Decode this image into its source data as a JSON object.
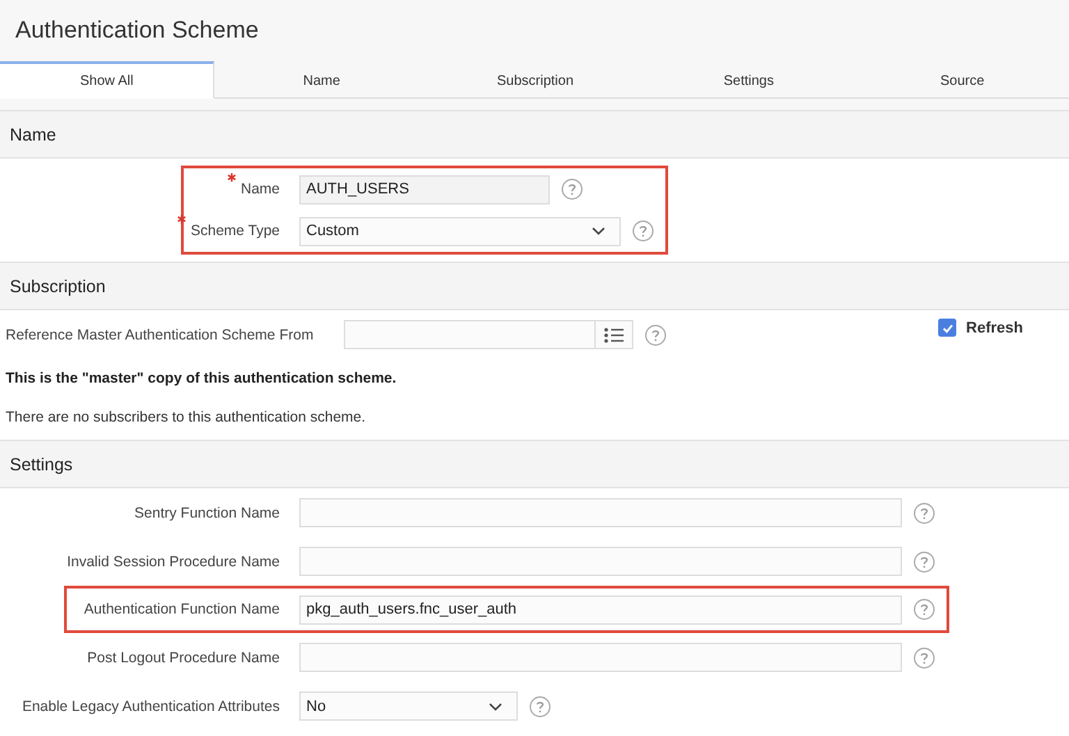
{
  "page_title": "Authentication Scheme",
  "tabs": [
    {
      "label": "Show All",
      "selected": true
    },
    {
      "label": "Name",
      "selected": false
    },
    {
      "label": "Subscription",
      "selected": false
    },
    {
      "label": "Settings",
      "selected": false
    },
    {
      "label": "Source",
      "selected": false
    }
  ],
  "sections": [
    {
      "title": "Name",
      "rows": [
        {
          "kind": "short_field",
          "label": "Name",
          "required": true,
          "value": "AUTH_USERS",
          "highlighted": true
        },
        {
          "kind": "select",
          "label": "Scheme Type",
          "required": true,
          "value": "Custom",
          "highlighted": true
        }
      ]
    },
    {
      "title": "Subscription",
      "rows": [
        {
          "kind": "lookup",
          "label": "Reference Master Authentication Scheme From",
          "checkbox": {
            "label": "Refresh",
            "checked": true
          }
        },
        {
          "kind": "bold_note",
          "text": "This is the \"master\" copy of this authentication scheme."
        },
        {
          "kind": "note",
          "text": "There are no subscribers to this authentication scheme."
        }
      ]
    },
    {
      "title": "Settings",
      "rows": [
        {
          "kind": "field",
          "label": "Sentry Function Name",
          "required": false,
          "highlighted": false
        },
        {
          "kind": "field",
          "label": "Invalid Session Procedure Name",
          "required": false,
          "highlighted": false
        },
        {
          "kind": "field",
          "label": "Authentication Function Name",
          "required": false,
          "value": "pkg_auth_users.fnc_user_auth",
          "highlighted": true
        },
        {
          "kind": "field",
          "label": "Post Logout Procedure Name",
          "required": false,
          "highlighted": false
        },
        {
          "kind": "short_select",
          "label": "Enable Legacy Authentication Attributes",
          "required": false,
          "value": "No",
          "highlighted": false
        }
      ]
    }
  ]
}
